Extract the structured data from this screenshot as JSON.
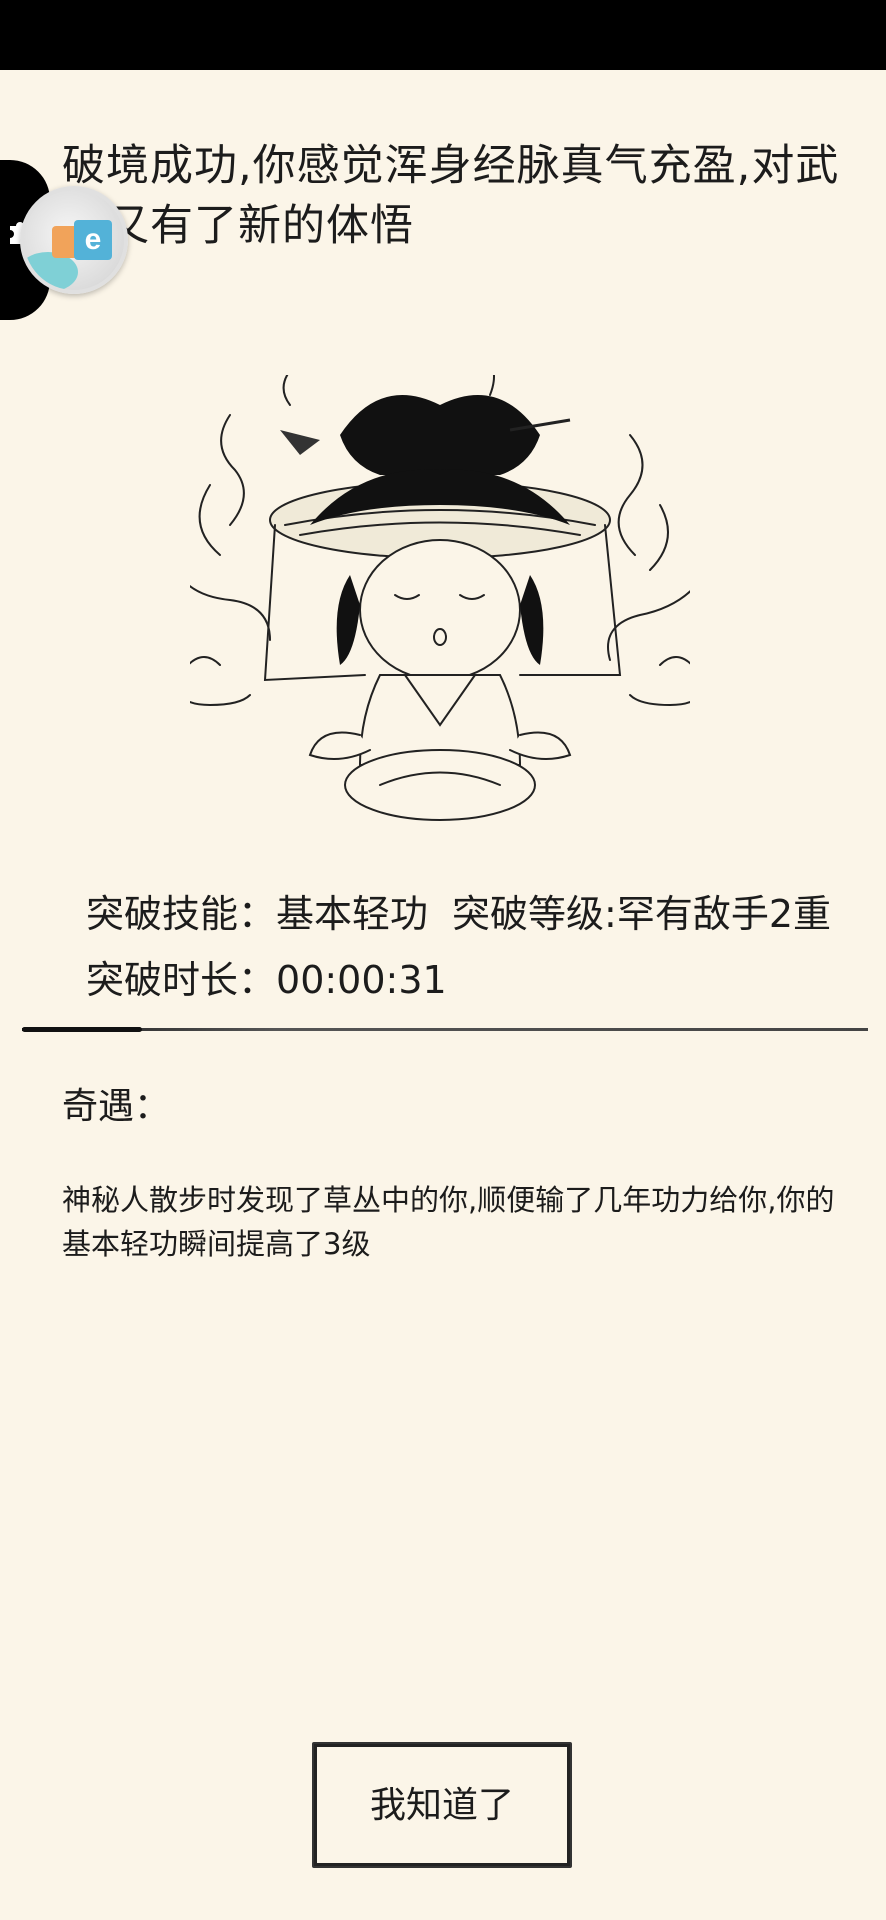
{
  "headline": "破境成功,你感觉浑身经脉真气充盈,对武学又有了新的体悟",
  "breakthrough": {
    "skill_label": "突破技能：",
    "skill_value": "基本轻功",
    "level_label": "突破等级:",
    "level_value": "罕有敌手2重",
    "duration_label": "突破时长：",
    "duration_value": "00:00:31"
  },
  "encounter": {
    "title": "奇遇：",
    "text": "神秘人散步时发现了草丛中的你,顺便输了几年功力给你,你的基本轻功瞬间提高了3级"
  },
  "button": {
    "label": "我知道了"
  },
  "overlay": {
    "left_tab_icon": "puzzle-icon",
    "floating_ball_icon": "app-logo-icon"
  },
  "colors": {
    "background": "#fbf5e8",
    "text": "#1c1c1c",
    "status_bar": "#000000"
  }
}
